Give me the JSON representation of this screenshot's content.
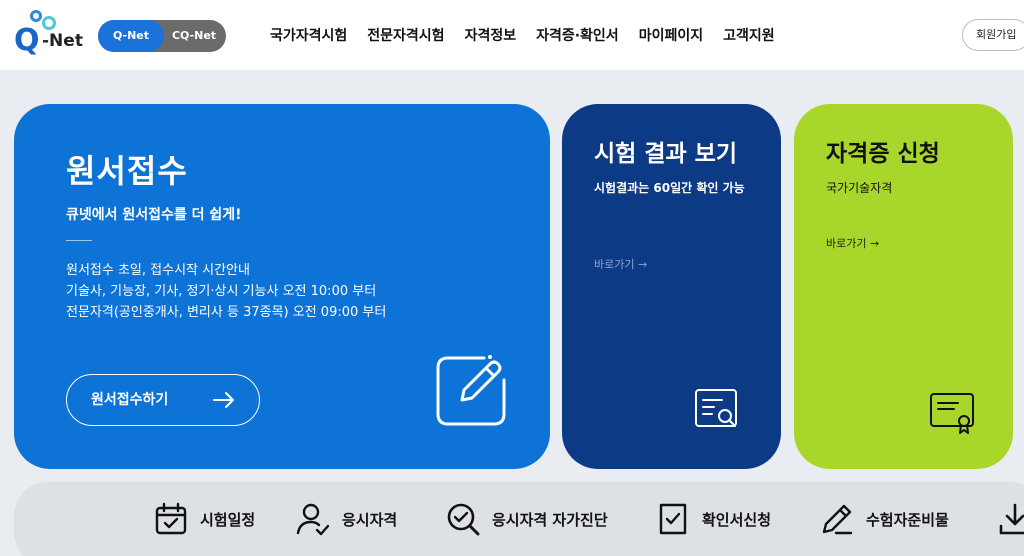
{
  "header": {
    "logo": {
      "q": "Q",
      "net": "-Net"
    },
    "toggle": {
      "active": "Q-Net",
      "inactive": "CQ-Net"
    },
    "nav": [
      "국가자격시험",
      "전문자격시험",
      "자격정보",
      "자격증·확인서",
      "마이페이지",
      "고객지원"
    ],
    "join_label": "회원가입"
  },
  "cards": {
    "main": {
      "title": "원서접수",
      "subtitle": "큐넷에서 원서접수를 더 쉽게!",
      "info": [
        "원서접수 초일, 접수시작 시간안내",
        "기술사, 기능장, 기사, 정기·상시 기능사 오전 10:00 부터",
        "전문자격(공인중개사, 변리사 등 37종목) 오전 09:00 부터"
      ],
      "button_label": "원서접수하기",
      "icon": "edit-icon",
      "color": "#0e73d6"
    },
    "result": {
      "title": "시험 결과 보기",
      "desc": "시험결과는 60일간 확인 가능",
      "link": "바로가기 →",
      "icon": "document-search-icon",
      "color": "#0c3a85"
    },
    "cert": {
      "title": "자격증 신청",
      "desc": "국가기술자격",
      "link": "바로가기 →",
      "icon": "certificate-icon",
      "color": "#a9d62a"
    }
  },
  "quick_menu": [
    {
      "label": "시험일정",
      "icon": "calendar-check-icon"
    },
    {
      "label": "응시자격",
      "icon": "user-check-icon"
    },
    {
      "label": "응시자격 자가진단",
      "icon": "search-check-icon"
    },
    {
      "label": "확인서신청",
      "icon": "document-check-icon"
    },
    {
      "label": "수험자준비물",
      "icon": "pencil-icon"
    },
    {
      "label": "",
      "icon": "download-icon"
    }
  ]
}
